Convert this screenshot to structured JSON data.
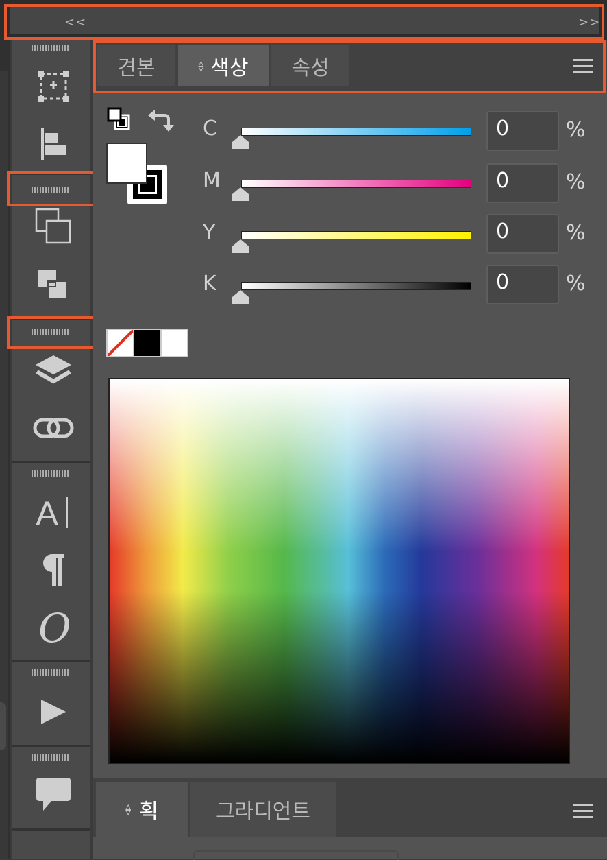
{
  "top_bar": {
    "collapse_left": "<<",
    "collapse_right": ">>"
  },
  "color_panel": {
    "tabs": [
      {
        "label": "견본",
        "active": false
      },
      {
        "label": "색상",
        "active": true
      },
      {
        "label": "속성",
        "active": false
      }
    ],
    "channels": [
      {
        "label": "C",
        "value": "0",
        "unit": "%",
        "gradient_end": "#00a0e9"
      },
      {
        "label": "M",
        "value": "0",
        "unit": "%",
        "gradient_end": "#e4007f"
      },
      {
        "label": "Y",
        "value": "0",
        "unit": "%",
        "gradient_end": "#fff100"
      },
      {
        "label": "K",
        "value": "0",
        "unit": "%",
        "gradient_end": "#000000"
      }
    ],
    "fill_color": "#ffffff",
    "stroke_color": "#000000",
    "quick_swatches": [
      "none",
      "#000000",
      "#ffffff"
    ]
  },
  "bottom_panel": {
    "tabs": [
      {
        "label": "획",
        "active": true
      },
      {
        "label": "그라디언트",
        "active": false
      }
    ]
  },
  "accent_color": "#e65a31"
}
